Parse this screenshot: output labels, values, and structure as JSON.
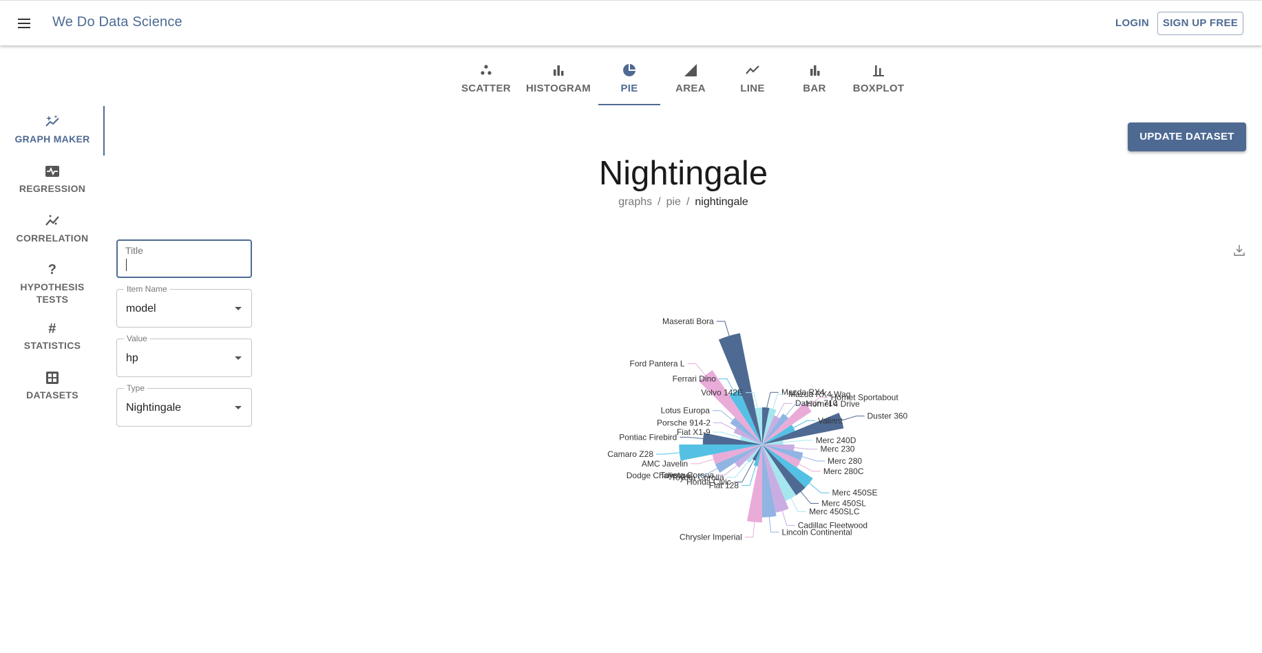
{
  "app": {
    "brand": "We Do Data Science",
    "login": "LOGIN",
    "signup": "SIGN UP FREE"
  },
  "tabs": [
    {
      "label": "SCATTER",
      "icon": "scatter-icon"
    },
    {
      "label": "HISTOGRAM",
      "icon": "histogram-icon"
    },
    {
      "label": "PIE",
      "icon": "pie-icon",
      "active": true
    },
    {
      "label": "AREA",
      "icon": "area-icon"
    },
    {
      "label": "LINE",
      "icon": "line-icon"
    },
    {
      "label": "BAR",
      "icon": "bar-icon"
    },
    {
      "label": "BOXPLOT",
      "icon": "boxplot-icon"
    }
  ],
  "sidebar": [
    {
      "label": "GRAPH MAKER",
      "icon": "sparkle-chart-icon",
      "active": true
    },
    {
      "label": "REGRESSION",
      "icon": "monitor-heart-icon"
    },
    {
      "label": "CORRELATION",
      "icon": "trend-icon"
    },
    {
      "label": "HYPOTHESIS TESTS",
      "icon": "question-icon"
    },
    {
      "label": "STATISTICS",
      "icon": "hash-icon"
    },
    {
      "label": "DATASETS",
      "icon": "grid-icon"
    }
  ],
  "actions": {
    "update_dataset": "UPDATE DATASET"
  },
  "page": {
    "title": "Nightingale",
    "crumbs": [
      "graphs",
      "pie",
      "nightingale"
    ]
  },
  "form": {
    "title": {
      "label": "Title",
      "value": ""
    },
    "item_name": {
      "label": "Item Name",
      "value": "model"
    },
    "value": {
      "label": "Value",
      "value": "hp"
    },
    "type": {
      "label": "Type",
      "value": "Nightingale"
    }
  },
  "colors": {
    "accent": "#4e6a93",
    "palette": [
      "#4e6a93",
      "#a5e6ef",
      "#c9ade2",
      "#92b4e3",
      "#e9acd9",
      "#54c0e4"
    ]
  },
  "chart_data": {
    "type": "pie",
    "variant": "nightingale-rose",
    "categories": [
      "Mazda RX4",
      "Mazda RX4 Wag",
      "Datsun 710",
      "Hornet 4 Drive",
      "Hornet Sportabout",
      "Valiant",
      "Duster 360",
      "Merc 240D",
      "Merc 230",
      "Merc 280",
      "Merc 280C",
      "Merc 450SE",
      "Merc 450SL",
      "Merc 450SLC",
      "Cadillac Fleetwood",
      "Lincoln Continental",
      "Chrysler Imperial",
      "Fiat 128",
      "Honda Civic",
      "Toyota Corolla",
      "Toyota Corona",
      "Dodge Challenger",
      "AMC Javelin",
      "Camaro Z28",
      "Pontiac Firebird",
      "Fiat X1-9",
      "Porsche 914-2",
      "Lotus Europa",
      "Ford Pantera L",
      "Ferrari Dino",
      "Maserati Bora",
      "Volvo 142E"
    ],
    "values": [
      110,
      110,
      93,
      110,
      175,
      105,
      245,
      62,
      95,
      123,
      123,
      180,
      180,
      180,
      205,
      215,
      230,
      66,
      52,
      65,
      97,
      150,
      150,
      245,
      175,
      66,
      91,
      113,
      264,
      175,
      335,
      109
    ]
  }
}
